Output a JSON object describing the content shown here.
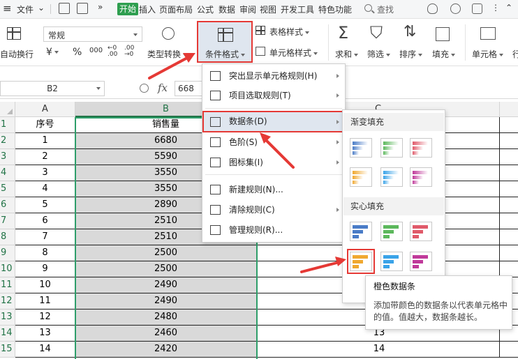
{
  "menubar": {
    "file": "文件",
    "start": "开始",
    "tabs": [
      "插入",
      "页面布局",
      "公式",
      "数据",
      "审阅",
      "视图",
      "开发工具",
      "特色功能"
    ],
    "search": "查找"
  },
  "ribbon": {
    "wrap": "自动换行",
    "number_format": "常规",
    "type_convert": "类型转换",
    "cond_format": "条件格式",
    "table_style": "表格样式",
    "cell_style": "单元格样式",
    "sum": "求和",
    "filter": "筛选",
    "sort": "排序",
    "fill": "填充",
    "cell": "单元格",
    "row_col": "行"
  },
  "formula_bar": {
    "name_box": "B2",
    "fx": "fx",
    "value": "668"
  },
  "sheet": {
    "columns": [
      "A",
      "B",
      "C"
    ],
    "header_row": {
      "row": "1",
      "a": "序号",
      "b": "销售量"
    },
    "rows": [
      {
        "row": "2",
        "a": "1",
        "b": "6680",
        "c": ""
      },
      {
        "row": "3",
        "a": "2",
        "b": "5590",
        "c": ""
      },
      {
        "row": "4",
        "a": "3",
        "b": "3550",
        "c": ""
      },
      {
        "row": "5",
        "a": "4",
        "b": "3550",
        "c": ""
      },
      {
        "row": "6",
        "a": "5",
        "b": "2890",
        "c": ""
      },
      {
        "row": "7",
        "a": "6",
        "b": "2510",
        "c": ""
      },
      {
        "row": "8",
        "a": "7",
        "b": "2510",
        "c": ""
      },
      {
        "row": "9",
        "a": "8",
        "b": "2500",
        "c": ""
      },
      {
        "row": "10",
        "a": "9",
        "b": "2500",
        "c": ""
      },
      {
        "row": "11",
        "a": "10",
        "b": "2490",
        "c": ""
      },
      {
        "row": "12",
        "a": "11",
        "b": "2490",
        "c": ""
      },
      {
        "row": "13",
        "a": "12",
        "b": "2480",
        "c": ""
      },
      {
        "row": "14",
        "a": "13",
        "b": "2460",
        "c": "13"
      },
      {
        "row": "15",
        "a": "14",
        "b": "2420",
        "c": "14"
      }
    ]
  },
  "dropdown": {
    "items": [
      "突出显示单元格规则(H)",
      "项目选取规则(T)",
      "数据条(D)",
      "色阶(S)",
      "图标集(I)",
      "新建规则(N)...",
      "清除规则(C)",
      "管理规则(R)..."
    ]
  },
  "submenu": {
    "gradient": "渐变填充",
    "solid": "实心填充",
    "colors": {
      "blue": "#4a7cc7",
      "green": "#5cb85c",
      "red": "#e05a6a",
      "orange": "#f0a830",
      "lightblue": "#3aa3e8",
      "purple": "#c03a9a"
    }
  },
  "tooltip": {
    "title": "橙色数据条",
    "desc": "添加带颜色的数据条以代表单元格中的值。值越大，数据条越长。"
  },
  "colors": {
    "accent_green": "#2e9e4f",
    "highlight_red": "#e53935"
  }
}
